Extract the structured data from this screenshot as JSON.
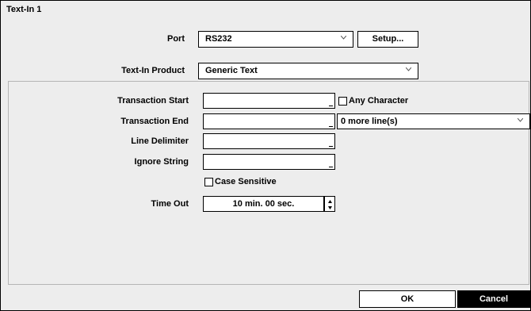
{
  "dialog": {
    "title": "Text-In 1"
  },
  "port": {
    "label": "Port",
    "value": "RS232",
    "setup_label": "Setup..."
  },
  "product": {
    "label": "Text-In Product",
    "value": "Generic Text"
  },
  "transaction_start": {
    "label": "Transaction Start",
    "value": "",
    "any_char_label": "Any Character",
    "any_char_checked": false
  },
  "transaction_end": {
    "label": "Transaction End",
    "value": "",
    "more_lines": "0 more line(s)"
  },
  "line_delimiter": {
    "label": "Line Delimiter",
    "value": ""
  },
  "ignore_string": {
    "label": "Ignore String",
    "value": ""
  },
  "case_sensitive": {
    "label": "Case Sensitive",
    "checked": false
  },
  "time_out": {
    "label": "Time Out",
    "value": "10 min. 00 sec."
  },
  "buttons": {
    "ok": "OK",
    "cancel": "Cancel"
  },
  "colors": {
    "panel_bg": "#ededed",
    "cancel_bg": "#000000",
    "cancel_fg": "#ffffff"
  },
  "icons": {
    "dropdown": "chevron-down-icon",
    "spin_up": "triangle-up-icon",
    "spin_down": "triangle-down-icon"
  }
}
